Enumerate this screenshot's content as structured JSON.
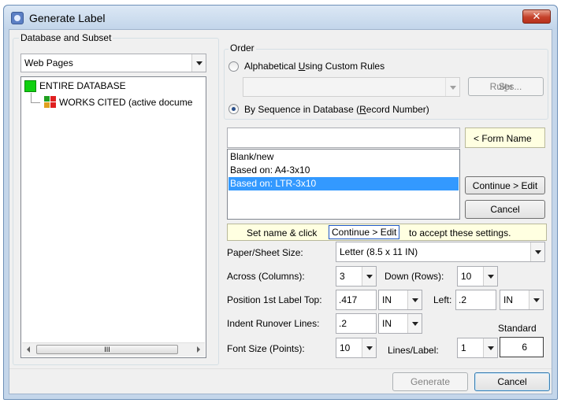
{
  "window": {
    "title": "Generate Label",
    "close_symbol": "✕"
  },
  "database": {
    "group_label": "Database and Subset",
    "selected": "Web Pages",
    "tree": [
      {
        "label": "ENTIRE DATABASE",
        "icon": "green-square-icon"
      },
      {
        "label": "WORKS CITED (active docume",
        "icon": "grid-icon"
      }
    ],
    "scroll_grip": "III"
  },
  "order": {
    "group_label": "Order",
    "alphabetical_label_pre": "Alphabetical ",
    "alphabetical_label_u": "U",
    "alphabetical_label_post": "sing Custom Rules",
    "custom_rules_value": "",
    "sort_rules_pre": "Sor",
    "sort_rules_u": "t",
    "sort_rules_post": " Rules...",
    "sequence_label_pre": "By Sequence in Database (",
    "sequence_label_u": "R",
    "sequence_label_post": "ecord Number)",
    "selected": "sequence"
  },
  "form": {
    "name_value": "",
    "form_name_label": "< Form Name",
    "items": [
      "Blank/new",
      "Based on: A4-3x10",
      "Based on: LTR-3x10"
    ],
    "selected_index": 2,
    "continue_label": "Continue > Edit",
    "cancel_label": "Cancel"
  },
  "hint": {
    "pre": "Set name & click",
    "link": "Continue > Edit",
    "post": "to accept these settings."
  },
  "settings": {
    "paper_label": "Paper/Sheet Size:",
    "paper_value": "Letter (8.5 x 11 IN)",
    "across_label": "Across (Columns):",
    "across_value": "3",
    "down_label": "Down (Rows):",
    "down_value": "10",
    "top_label": "Position 1st Label Top:",
    "top_value": ".417",
    "top_unit": "IN",
    "left_label": "Left:",
    "left_value": ".2",
    "left_unit": "IN",
    "indent_label": "Indent Runover Lines:",
    "indent_value": ".2",
    "indent_unit": "IN",
    "font_label": "Font Size (Points):",
    "font_value": "10",
    "lines_label": "Lines/Label:",
    "lines_value": "1",
    "standard_label": "Standard",
    "standard_value": "6"
  },
  "footer": {
    "generate_label": "Generate",
    "cancel_label": "Cancel"
  }
}
